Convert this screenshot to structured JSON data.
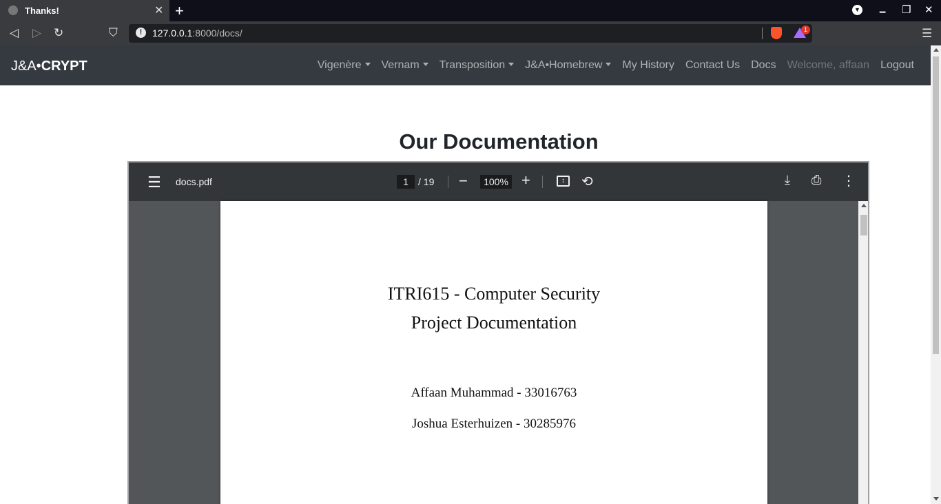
{
  "browser": {
    "tab_title": "Thanks!",
    "tab_close": "✕",
    "new_tab": "+",
    "url_host": "127.0.0.1",
    "url_rest": ":8000/docs/",
    "rewards_badge": "1",
    "menu_icon": "☰"
  },
  "site": {
    "brand_prefix": "J&A•",
    "brand_bold": "CRYPT",
    "nav": {
      "vigenere": "Vigenère",
      "vernam": "Vernam",
      "transposition": "Transposition",
      "homebrew": "J&A•Homebrew",
      "history": "My History",
      "contact": "Contact Us",
      "docs": "Docs",
      "welcome": "Welcome, affaan",
      "logout": "Logout"
    }
  },
  "page": {
    "title": "Our Documentation"
  },
  "pdf_viewer": {
    "filename": "docs.pdf",
    "current_page": "1",
    "total_pages": "/ 19",
    "zoom": "100%",
    "document": {
      "title_line1": "ITRI615 - Computer Security",
      "title_line2": "Project Documentation",
      "author1": "Affaan Muhammad - 33016763",
      "author2": "Joshua Esterhuizen - 30285976"
    }
  }
}
